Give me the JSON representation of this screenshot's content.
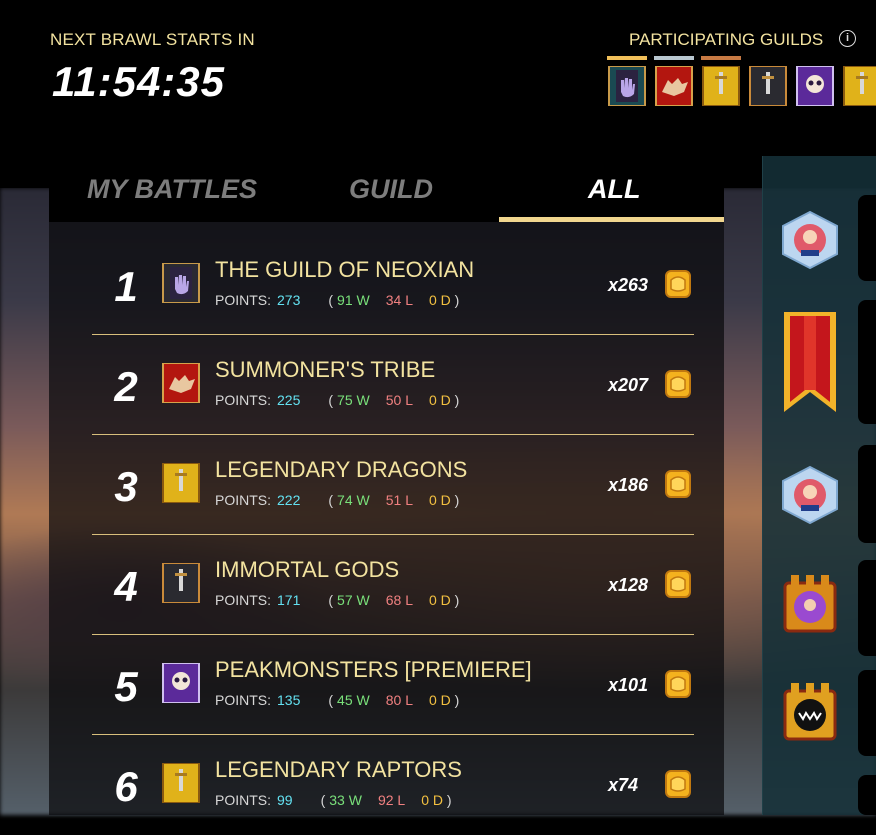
{
  "header": {
    "next_brawl_label": "NEXT BRAWL STARTS IN",
    "timer": "11:54:35",
    "participating_label": "PARTICIPATING GUILDS",
    "info_glyph": "i",
    "guild_icons": [
      "hand-banner-icon",
      "wolf-banner-icon",
      "sword-gold-banner-icon",
      "sword-dark-banner-icon",
      "skull-purple-banner-icon",
      "sword-gold-banner-icon"
    ]
  },
  "tabs": [
    {
      "label": "MY BATTLES"
    },
    {
      "label": "GUILD"
    },
    {
      "label": "ALL"
    }
  ],
  "labels": {
    "points": "POINTS:"
  },
  "rows": [
    {
      "rank": "1",
      "name": "THE GUILD OF NEOXIAN",
      "points": "273",
      "w": "91 W",
      "l": "34 L",
      "d": "0 D",
      "mult": "x263",
      "icon": "hand-banner-icon"
    },
    {
      "rank": "2",
      "name": "SUMMONER'S TRIBE",
      "points": "225",
      "w": "75 W",
      "l": "50 L",
      "d": "0 D",
      "mult": "x207",
      "icon": "wolf-banner-icon"
    },
    {
      "rank": "3",
      "name": "LEGENDARY DRAGONS",
      "points": "222",
      "w": "74 W",
      "l": "51 L",
      "d": "0 D",
      "mult": "x186",
      "icon": "sword-gold-banner-icon"
    },
    {
      "rank": "4",
      "name": "IMMORTAL GODS",
      "points": "171",
      "w": "57 W",
      "l": "68 L",
      "d": "0 D",
      "mult": "x128",
      "icon": "sword-dark-banner-icon"
    },
    {
      "rank": "5",
      "name": "PEAKMONSTERS [PREMIERE]",
      "points": "135",
      "w": "45 W",
      "l": "80 L",
      "d": "0 D",
      "mult": "x101",
      "icon": "skull-purple-banner-icon"
    },
    {
      "rank": "6",
      "name": "LEGENDARY RAPTORS",
      "points": "99",
      "w": "33 W",
      "l": "92 L",
      "d": "0 D",
      "mult": "x74",
      "icon": "sword-gold-banner-icon"
    }
  ],
  "colors": {
    "gold_text": "#f3e3a0",
    "tab_underline": "#f1d68e",
    "points": "#63e0f0",
    "wins": "#79e07a",
    "losses": "#f08080",
    "draws": "#f2c040"
  }
}
